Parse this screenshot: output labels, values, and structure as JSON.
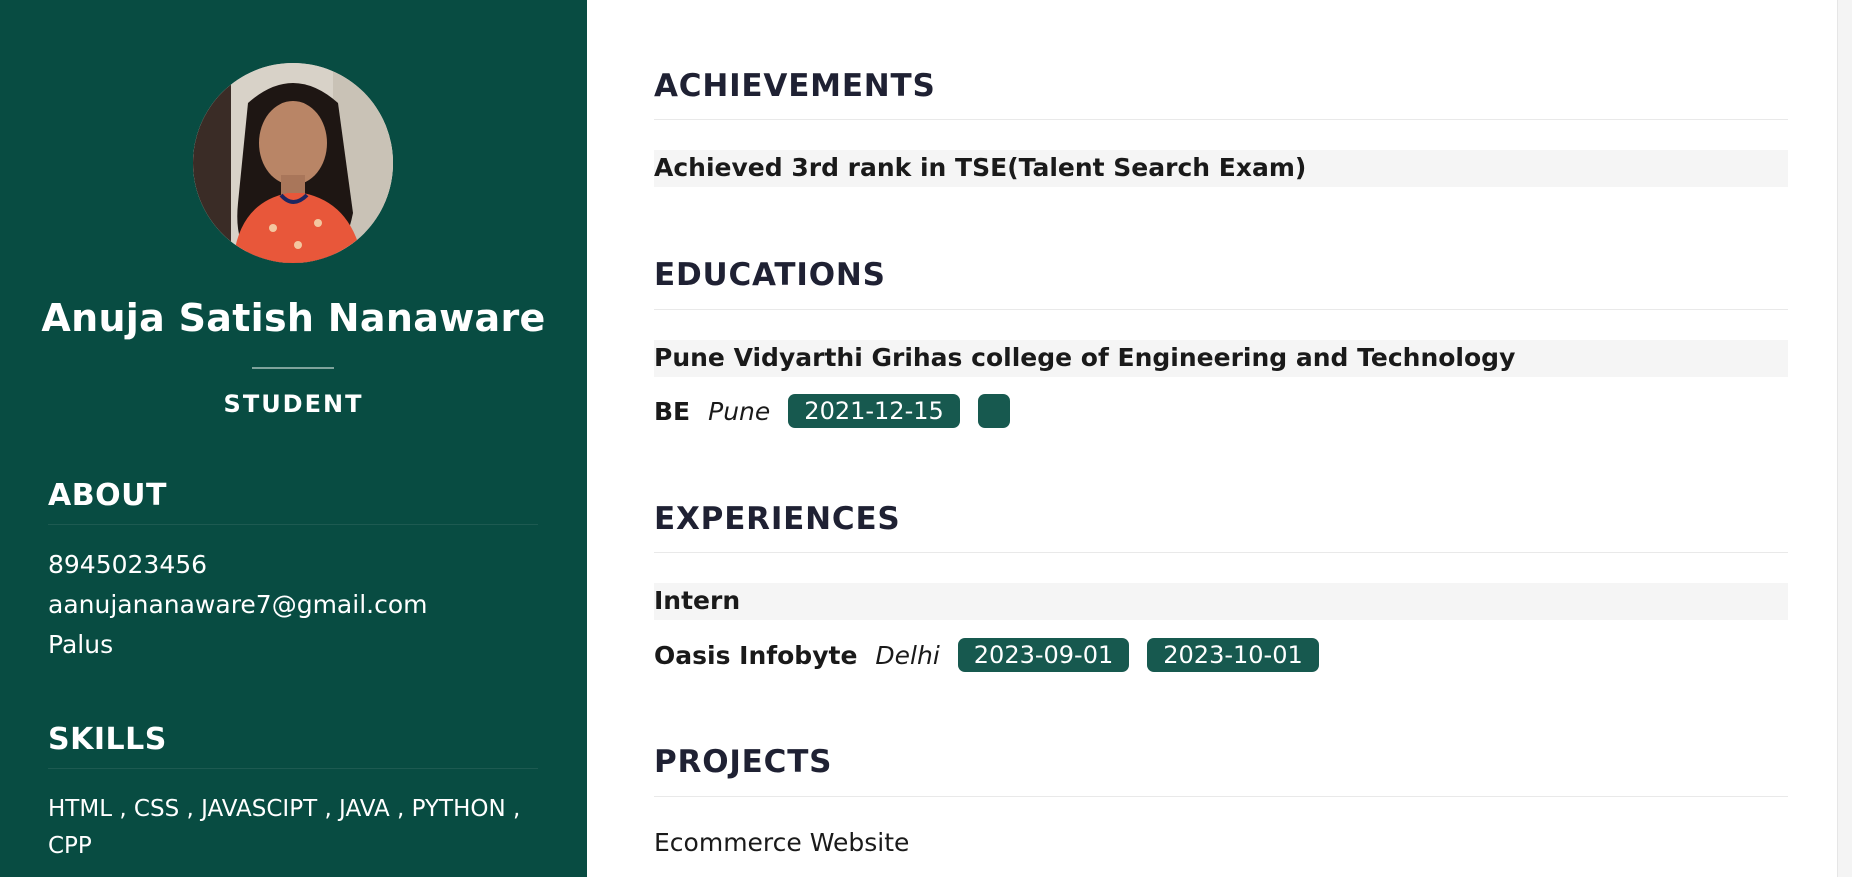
{
  "profile": {
    "name": "Anuja Satish Nanaware",
    "role": "STUDENT"
  },
  "about": {
    "heading": "ABOUT",
    "phone": "8945023456",
    "email": "aanujananaware7@gmail.com",
    "location": "Palus"
  },
  "skills": {
    "heading": "SKILLS",
    "text": "HTML , CSS , JAVASCIPT , JAVA , PYTHON , CPP"
  },
  "achievements": {
    "heading": "ACHIEVEMENTS",
    "items": [
      {
        "title": "Achieved 3rd rank in TSE(Talent Search Exam)"
      }
    ]
  },
  "educations": {
    "heading": "EDUCATIONS",
    "items": [
      {
        "institution": "Pune Vidyarthi Grihas college of Engineering and Technology",
        "degree": "BE",
        "place": "Pune",
        "start": "2021-12-15",
        "end": ""
      }
    ]
  },
  "experiences": {
    "heading": "EXPERIENCES",
    "items": [
      {
        "title": "Intern",
        "company": "Oasis Infobyte",
        "place": "Delhi",
        "start": "2023-09-01",
        "end": "2023-10-01"
      }
    ]
  },
  "projects": {
    "heading": "PROJECTS",
    "items": [
      {
        "title": "Ecommerce Website"
      }
    ]
  },
  "colors": {
    "sidebar_bg": "#084c42",
    "badge_bg": "#17594f",
    "heading_text": "#1f2133"
  }
}
